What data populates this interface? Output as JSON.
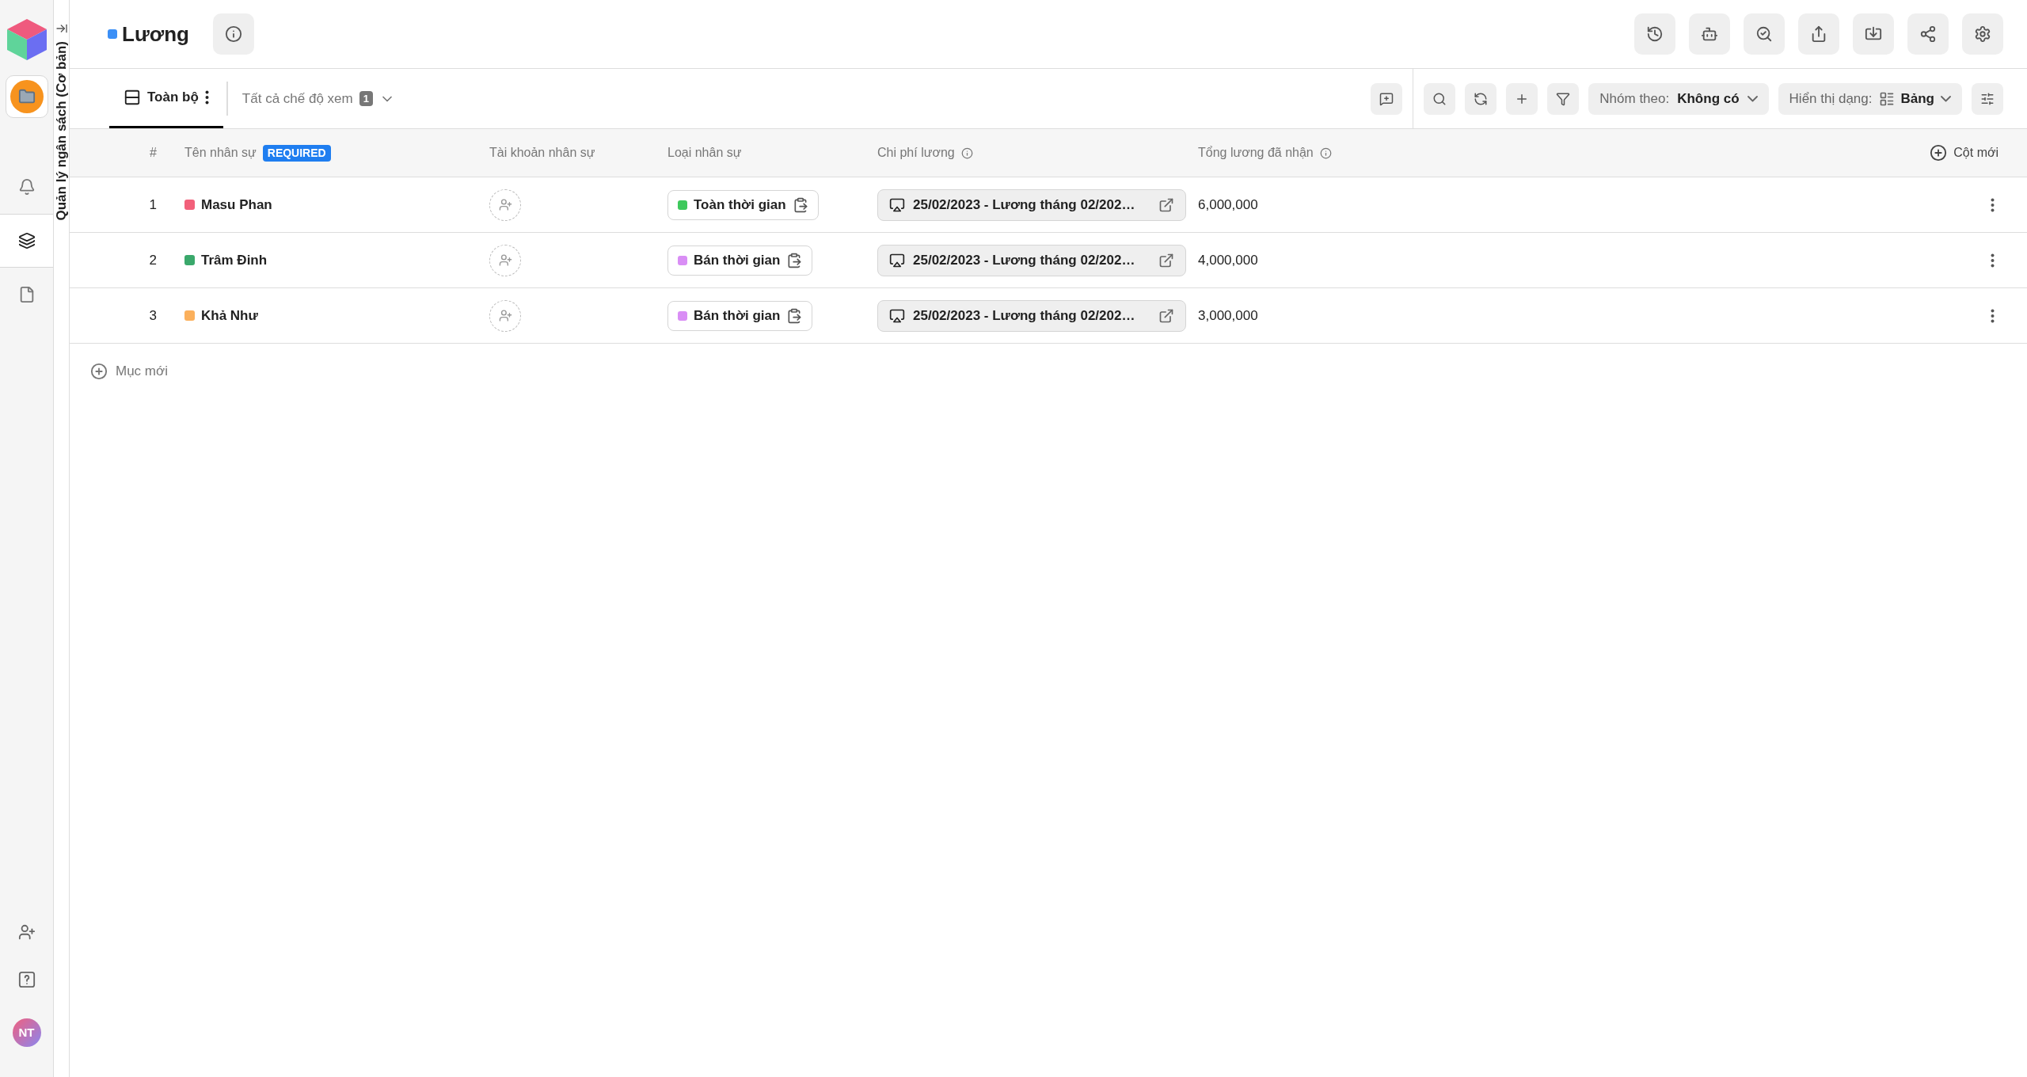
{
  "sidebar": {
    "nav": [
      {
        "selected": true
      },
      {
        "selected": false
      },
      {
        "selected": true
      },
      {
        "selected": false
      }
    ],
    "avatar": "NT"
  },
  "workspace_title": "Quản lý ngân sách (Cơ bản)",
  "page": {
    "title": "Lương",
    "color": "#3b8ff6"
  },
  "views": {
    "tabs": [
      {
        "label": "Toàn bộ",
        "selected": true
      }
    ],
    "all_views": "Tất cả chế độ xem",
    "count": "1"
  },
  "toolbar": {
    "group_label": "Nhóm theo:",
    "group_value": "Không có",
    "display_label": "Hiển thị dạng:",
    "display_value": "Bảng"
  },
  "table": {
    "columns": [
      {
        "label": "#",
        "info": false
      },
      {
        "label": "Tên nhân sự",
        "badge": "REQUIRED",
        "info": false
      },
      {
        "label": "Tài khoản nhân sự",
        "info": false
      },
      {
        "label": "Loại nhân sự",
        "info": false
      },
      {
        "label": "Chi phí lương",
        "info": true
      },
      {
        "label": "Tổng lương đã nhận",
        "info": true
      }
    ],
    "new_column": "Cột mới",
    "rows": [
      {
        "index": "1",
        "name": "Masu Phan",
        "color": "#f2607a",
        "type": {
          "label": "Toàn thời gian",
          "color": "#3ec95c"
        },
        "cost": "25/02/2023 - Lương tháng 02/202…",
        "total": "6,000,000"
      },
      {
        "index": "2",
        "name": "Trâm Đinh",
        "color": "#3aa86b",
        "type": {
          "label": "Bán thời gian",
          "color": "#d98ef5"
        },
        "cost": "25/02/2023 - Lương tháng 02/202…",
        "total": "4,000,000"
      },
      {
        "index": "3",
        "name": "Khả Như",
        "color": "#fbb05c",
        "type": {
          "label": "Bán thời gian",
          "color": "#d98ef5"
        },
        "cost": "25/02/2023 - Lương tháng 02/202…",
        "total": "3,000,000"
      }
    ],
    "new_row": "Mục mới"
  }
}
